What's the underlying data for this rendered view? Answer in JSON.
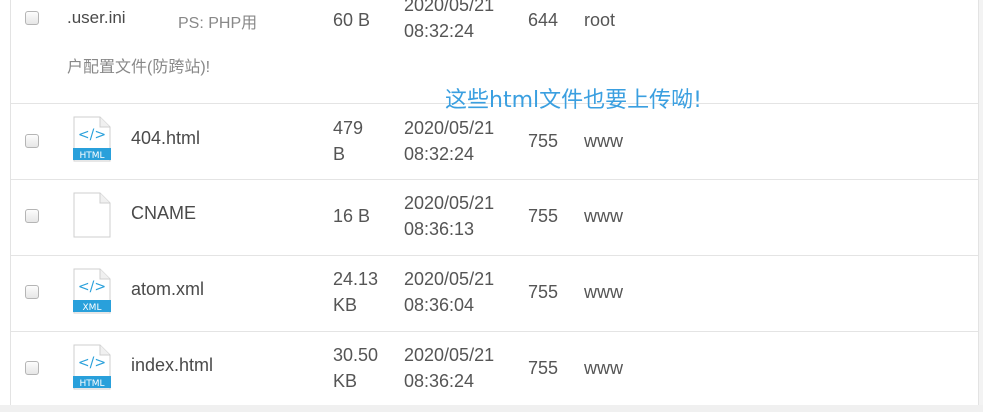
{
  "annotation": "这些html文件也要上传呦!",
  "files": [
    {
      "name": ".user.ini",
      "remark_line1": "PS: PHP用",
      "remark_line2": "户配置文件(防跨站)!",
      "size_line1": "60 B",
      "size_line2": "",
      "date": "2020/05/21",
      "time": "08:32:24",
      "permission": "644",
      "owner": "root",
      "icon": "none",
      "icon_label": ""
    },
    {
      "name": "404.html",
      "size_line1": "479",
      "size_line2": "B",
      "date": "2020/05/21",
      "time": "08:32:24",
      "permission": "755",
      "owner": "www",
      "icon": "html-file-icon",
      "icon_label": "HTML"
    },
    {
      "name": "CNAME",
      "size_line1": "16 B",
      "size_line2": "",
      "date": "2020/05/21",
      "time": "08:36:13",
      "permission": "755",
      "owner": "www",
      "icon": "blank-file-icon",
      "icon_label": ""
    },
    {
      "name": "atom.xml",
      "size_line1": "24.13",
      "size_line2": "KB",
      "date": "2020/05/21",
      "time": "08:36:04",
      "permission": "755",
      "owner": "www",
      "icon": "xml-file-icon",
      "icon_label": "XML"
    },
    {
      "name": "index.html",
      "size_line1": "30.50",
      "size_line2": "KB",
      "date": "2020/05/21",
      "time": "08:36:24",
      "permission": "755",
      "owner": "www",
      "icon": "html-file-icon",
      "icon_label": "HTML"
    }
  ],
  "colors": {
    "annotation": "#3a9fe0",
    "icon_badge": "#29a0db",
    "row_border": "#e4e4e4"
  }
}
